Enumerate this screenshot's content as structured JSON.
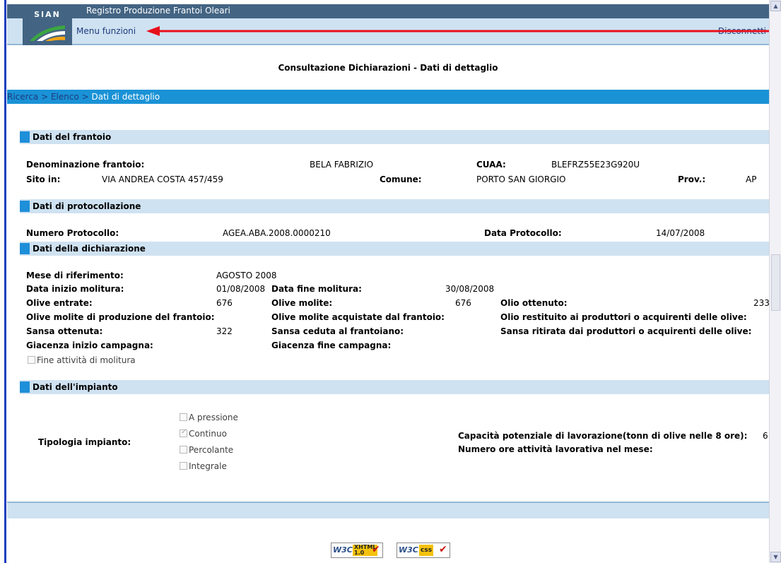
{
  "header": {
    "app_title": "Registro Produzione Frantoi Oleari",
    "logo_text": "SIAN",
    "menu_label": "Menu funzioni",
    "logout_label": "Disconnetti"
  },
  "page_title": "Consultazione Dichiarazioni - Dati di dettaglio",
  "breadcrumb": {
    "items": [
      "Ricerca",
      "Elenco",
      "Dati di dettaglio"
    ],
    "separator": " > "
  },
  "sections": {
    "frantoio": {
      "title": "Dati del frantoio",
      "denominazione_label": "Denominazione frantoio:",
      "denominazione_value": "BELA FABRIZIO",
      "cuaa_label": "CUAA:",
      "cuaa_value": "BLEFRZ55E23G920U",
      "sito_label": "Sito in:",
      "sito_value": "VIA ANDREA COSTA 457/459",
      "comune_label": "Comune:",
      "comune_value": "PORTO SAN GIORGIO",
      "prov_label": "Prov.:",
      "prov_value": "AP"
    },
    "protocollo": {
      "title": "Dati di protocollazione",
      "numero_label": "Numero Protocollo:",
      "numero_value": "AGEA.ABA.2008.0000210",
      "data_label": "Data Protocollo:",
      "data_value": "14/07/2008"
    },
    "dichiarazione": {
      "title": "Dati della dichiarazione",
      "mese_label": "Mese di riferimento:",
      "mese_value": "AGOSTO 2008",
      "inizio_label": "Data inizio molitura:",
      "inizio_value": "01/08/2008",
      "fine_label": "Data fine molitura:",
      "fine_value": "30/08/2008",
      "olive_entrate_label": "Olive entrate:",
      "olive_entrate_value": "676",
      "olive_molite_label": "Olive molite:",
      "olive_molite_value": "676",
      "olio_ottenuto_label": "Olio ottenuto:",
      "olio_ottenuto_value": "233",
      "molite_prod_label": "Olive molite di produzione del frantoio:",
      "molite_acq_label": "Olive molite acquistate dal frantoio:",
      "olio_restituito_label": "Olio restituito ai produttori o acquirenti delle olive:",
      "sansa_ottenuta_label": "Sansa ottenuta:",
      "sansa_ottenuta_value": "322",
      "sansa_ceduta_label": "Sansa ceduta al frantoiano:",
      "sansa_ritirata_label": "Sansa ritirata dai produttori o acquirenti delle olive:",
      "giacenza_inizio_label": "Giacenza inizio campagna:",
      "giacenza_fine_label": "Giacenza fine campagna:",
      "fine_attivita_label": "Fine attività di molitura",
      "fine_attivita_checked": false
    },
    "impianto": {
      "title": "Dati dell'impianto",
      "tipologia_label": "Tipologia impianto:",
      "options": [
        {
          "label": "A pressione",
          "checked": false
        },
        {
          "label": "Continuo",
          "checked": true
        },
        {
          "label": "Percolante",
          "checked": false
        },
        {
          "label": "Integrale",
          "checked": false
        }
      ],
      "capacita_label": "Capacità potenziale di lavorazione(tonn di olive nelle 8 ore):",
      "capacita_value": "6",
      "ore_label": "Numero ore attività lavorativa nel mese:"
    }
  },
  "footer": {
    "xhtml_badge": {
      "brand": "W3C",
      "tag_top": "XHTML",
      "tag_bottom": "1.0"
    },
    "css_badge": {
      "brand": "W3C",
      "tag": "css"
    }
  },
  "colors": {
    "header_dark": "#436483",
    "header_light": "#cfe2f1",
    "breadcrumb_blue": "#1a92d6",
    "section_square": "#1e8fd9",
    "annotation_arrow": "#e8101a"
  }
}
